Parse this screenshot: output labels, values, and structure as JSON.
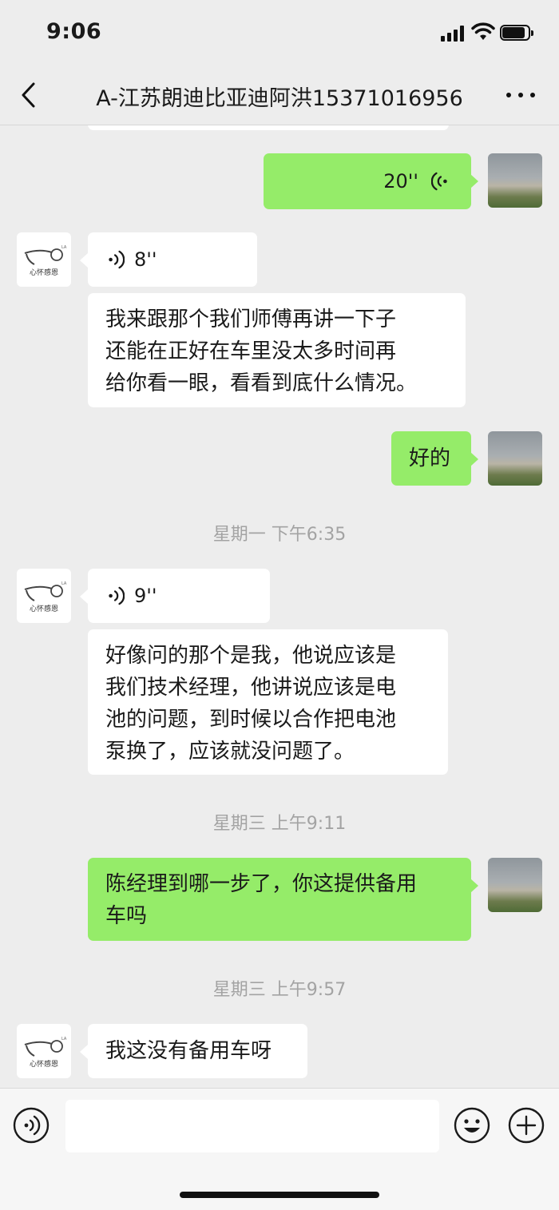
{
  "status_bar": {
    "time": "9:06"
  },
  "nav": {
    "title": "A-江苏朗迪比亚迪阿洪15371016956"
  },
  "contact": {
    "avatar_text": "心怀感恩"
  },
  "messages": [
    {
      "kind": "voice",
      "duration": "20''"
    },
    {
      "kind": "voice",
      "duration": "8''"
    },
    {
      "kind": "text",
      "lines": [
        "我来跟那个我们师傅再讲一下子",
        "还能在正好在车里没太多时间再",
        "给你看一眼，看看到底什么情况。"
      ]
    },
    {
      "kind": "text",
      "lines": [
        "好的"
      ]
    },
    {
      "kind": "timestamp",
      "text": "星期一 下午6:35"
    },
    {
      "kind": "voice",
      "duration": "9''"
    },
    {
      "kind": "text",
      "lines": [
        "好像问的那个是我，他说应该是",
        "我们技术经理，他讲说应该是电",
        "池的问题，到时候以合作把电池",
        "泵换了，应该就没问题了。"
      ]
    },
    {
      "kind": "timestamp",
      "text": "星期三 上午9:11"
    },
    {
      "kind": "text",
      "lines": [
        "陈经理到哪一步了，你这提供备用",
        "车吗"
      ]
    },
    {
      "kind": "timestamp",
      "text": "星期三 上午9:57"
    },
    {
      "kind": "text",
      "lines": [
        "我这没有备用车呀"
      ]
    }
  ],
  "input_bar": {
    "placeholder": ""
  }
}
